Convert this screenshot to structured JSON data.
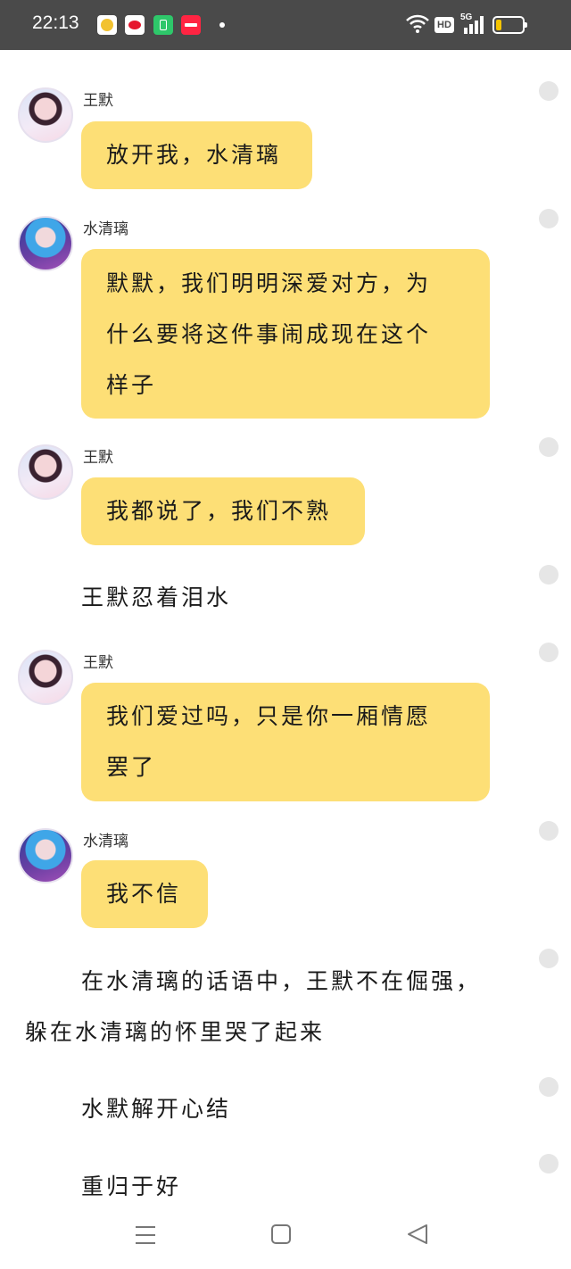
{
  "status_bar": {
    "time": "22:13",
    "network": "HD",
    "network_gen": "5G",
    "app_icons": [
      "notes-app-icon",
      "weibo-icon",
      "battery-app-icon",
      "xiaohongshu-icon"
    ],
    "battery_level": 0.15,
    "colors": {
      "bg": "#4a4a4a",
      "battery": "#f5c400"
    }
  },
  "chat": {
    "bubble_color": "#fddf76",
    "messages": [
      {
        "speaker": "王默",
        "text": "放开我，水清璃"
      },
      {
        "speaker": "水清璃",
        "lines": [
          "默默，我们明明深爱对方，为",
          "什么要将这件事闹成现在这个",
          "样子"
        ]
      },
      {
        "speaker": "王默",
        "text": "我都说了，我们不熟"
      },
      {
        "narration": "王默忍着泪水"
      },
      {
        "speaker": "王默",
        "lines": [
          "我们爱过吗，只是你一厢情愿",
          "罢了"
        ]
      },
      {
        "speaker": "水清璃",
        "text": "我不信"
      },
      {
        "narration_lines": [
          "在水清璃的话语中，王默不在倔强，",
          "躲在水清璃的怀里哭了起来"
        ]
      },
      {
        "narration": "水默解开心结"
      },
      {
        "narration": "重归于好"
      }
    ]
  },
  "nav_bar": {
    "buttons": [
      "menu-icon",
      "home-icon",
      "back-icon"
    ]
  }
}
